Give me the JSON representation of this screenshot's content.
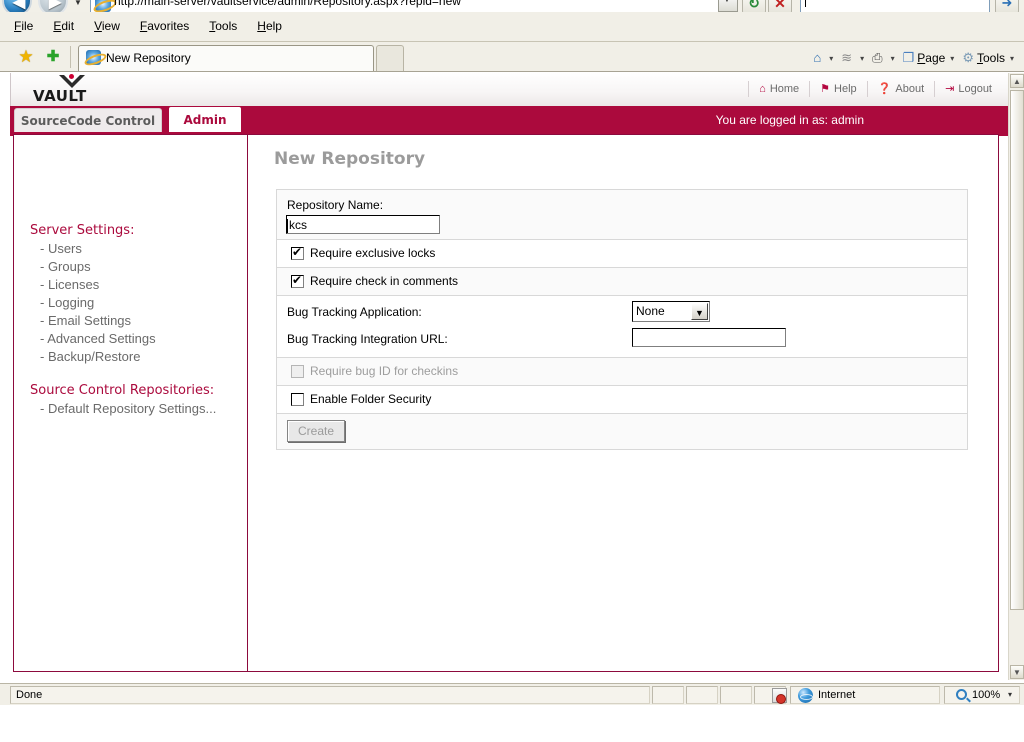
{
  "browser": {
    "address_url": "http://main-server/vaultservice/admin/Repository.aspx?repid=new",
    "back_glyph": "◀",
    "forward_glyph": "▶",
    "history_caret": "▼",
    "refresh_glyph": "↻",
    "stop_glyph": "✕",
    "search_go_glyph": "➜",
    "menus": [
      "File",
      "Edit",
      "View",
      "Favorites",
      "Tools",
      "Help"
    ],
    "tab_title": "New Repository",
    "favorites_star": "★",
    "favorites_add": "✚",
    "commands": [
      {
        "label": "",
        "glyph": "⌂",
        "name": "home"
      },
      {
        "label": "",
        "glyph": "≋",
        "name": "feeds"
      },
      {
        "label": "",
        "glyph": "⎙",
        "name": "print"
      },
      {
        "label": "Page",
        "glyph": "❐",
        "name": "page"
      },
      {
        "label": "Tools",
        "glyph": "⚙",
        "name": "tools"
      }
    ],
    "caret": "▾"
  },
  "app": {
    "logo_text": "VAULT",
    "header_links": [
      {
        "label": "Home",
        "glyph": "⌂"
      },
      {
        "label": "Help",
        "glyph": "⚑"
      },
      {
        "label": "About",
        "glyph": "❓"
      },
      {
        "label": "Logout",
        "glyph": "⇥"
      }
    ],
    "tabs": [
      {
        "label": "SourceCode Control",
        "active": false
      },
      {
        "label": "Admin",
        "active": true
      }
    ],
    "logged_in_text": "You are logged in as: admin",
    "accent_color": "#ab0a3d",
    "border_color": "#8c0a3d"
  },
  "sidebar": {
    "groups": [
      {
        "title": "Server Settings:",
        "items": [
          "- Users",
          "- Groups",
          "- Licenses",
          "- Logging",
          "- Email Settings",
          "- Advanced Settings",
          "- Backup/Restore"
        ]
      },
      {
        "title": "Source Control Repositories:",
        "items": [
          "- Default Repository Settings..."
        ]
      }
    ]
  },
  "main": {
    "page_title": "New Repository",
    "form": {
      "repository_name_label": "Repository Name:",
      "repository_name_value": "kcs",
      "require_exclusive_locks_label": "Require exclusive locks",
      "require_exclusive_locks_checked": true,
      "require_checkin_comments_label": "Require check in comments",
      "require_checkin_comments_checked": true,
      "bug_tracking_app_label": "Bug Tracking Application:",
      "bug_tracking_app_value": "None",
      "bug_tracking_url_label": "Bug Tracking Integration URL:",
      "bug_tracking_url_value": "",
      "require_bug_id_label": "Require bug ID for checkins",
      "require_bug_id_checked": false,
      "require_bug_id_disabled": true,
      "enable_folder_security_label": "Enable Folder Security",
      "enable_folder_security_checked": false,
      "create_button_label": "Create",
      "create_button_disabled": true
    }
  },
  "statusbar": {
    "status_text": "Done",
    "zone_text": "Internet",
    "zoom_text": "100%",
    "zoom_caret": "▾"
  }
}
